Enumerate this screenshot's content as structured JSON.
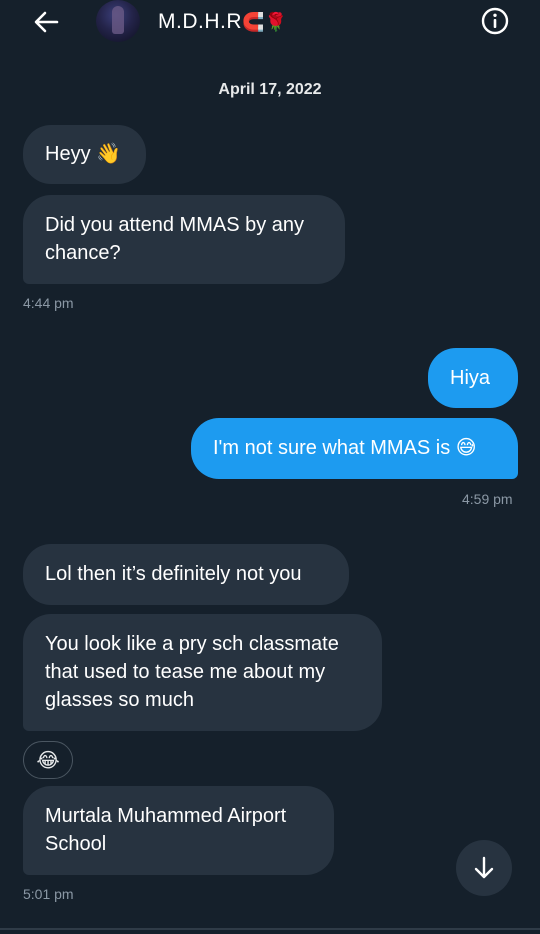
{
  "header": {
    "contact_name": "M.D.H.R",
    "name_emojis": "🧲🌹",
    "icons": {
      "back": "arrow-left-icon",
      "info": "info-icon"
    }
  },
  "conversation": {
    "date_separator": "April 17, 2022",
    "messages": [
      {
        "direction": "in",
        "text": "Heyy",
        "emoji": "👋"
      },
      {
        "direction": "in",
        "text": "Did you attend MMAS by any chance?",
        "line1": "Did you attend MMAS by any",
        "line2": "chance?"
      },
      {
        "direction": "out",
        "text": "Hiya"
      },
      {
        "direction": "out",
        "text": "I'm not sure what MMAS is",
        "emoji": "😅"
      },
      {
        "direction": "in",
        "text": "Lol then it’s definitely not you"
      },
      {
        "direction": "in",
        "text": "You look like a pry sch classmate that used to tease me about my glasses so much",
        "line1": "You look like a pry sch classmate",
        "line2": "that used to tease me about my",
        "line3": "glasses so much",
        "reaction": "😂"
      },
      {
        "direction": "in",
        "text": "Murtala Muhammed Airport School",
        "line1": "Murtala Muhammed Airport",
        "line2": "School"
      }
    ],
    "timestamps": [
      "4:44 pm",
      "4:59 pm",
      "5:01 pm"
    ]
  },
  "colors": {
    "background": "#15202b",
    "incoming_bubble": "#273340",
    "outgoing_bubble": "#1d9bf0",
    "timestamp": "#8b98a5"
  }
}
